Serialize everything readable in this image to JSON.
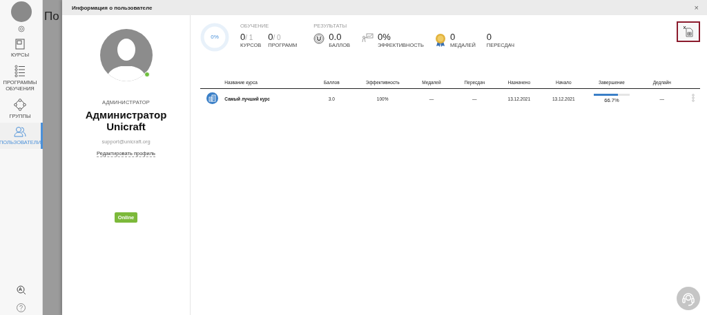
{
  "nav": {
    "items": [
      {
        "kind": "courses",
        "label": "КУРСЫ",
        "selected": false
      },
      {
        "kind": "programs",
        "label": "ПРОГРАММЫ ОБУЧЕНИЯ",
        "selected": false
      },
      {
        "kind": "groups",
        "label": "ГРУППЫ",
        "selected": false
      },
      {
        "kind": "users",
        "label": "ПОЛЬЗОВАТЕЛИ",
        "selected": true
      }
    ]
  },
  "background": {
    "heading": "По"
  },
  "modal": {
    "title": "Информация о пользователе",
    "close": "×",
    "profile": {
      "role": "АДМИНИСТРАТОР",
      "name": "Администратор Unicraft",
      "email": "support@unicraft.org",
      "edit_link": "Редактировать профиль",
      "online": true,
      "status": "Online"
    },
    "progress": {
      "reading": "0%"
    },
    "learning": {
      "heading": "ОБУЧЕНИЕ",
      "items": [
        {
          "value": "0",
          "total": "/ 1",
          "label": "КУРСОВ"
        },
        {
          "value": "0",
          "total": "/ 0",
          "label": "ПРОГРАММ"
        }
      ]
    },
    "results": {
      "heading": "РЕЗУЛЬТАТЫ",
      "items": [
        {
          "kind": "points",
          "value": "0.0",
          "label": "БАЛЛОВ"
        },
        {
          "kind": "efficiency",
          "value": "0%",
          "label": "ЭФФЕКТИВНОСТЬ"
        },
        {
          "kind": "medals",
          "value": "0",
          "label": "МЕДАЛЕЙ"
        },
        {
          "kind": "plain",
          "value": "0",
          "label": "ПЕРЕСДАЧ"
        }
      ]
    },
    "table": {
      "columns": [
        "Название курса",
        "Баллов",
        "Эффективность",
        "Медалей",
        "Пересдач",
        "Назначено",
        "Начало",
        "Завершение",
        "Дедлайн"
      ],
      "rows": [
        {
          "name": "Самый лучший курс",
          "points": "3.0",
          "efficiency": "100%",
          "medals": "—",
          "retakes": "—",
          "assigned": "13.12.2021",
          "start": "13.12.2021",
          "completion": {
            "level": 0.667,
            "reading": "66.7%"
          },
          "deadline": "—"
        }
      ]
    }
  }
}
